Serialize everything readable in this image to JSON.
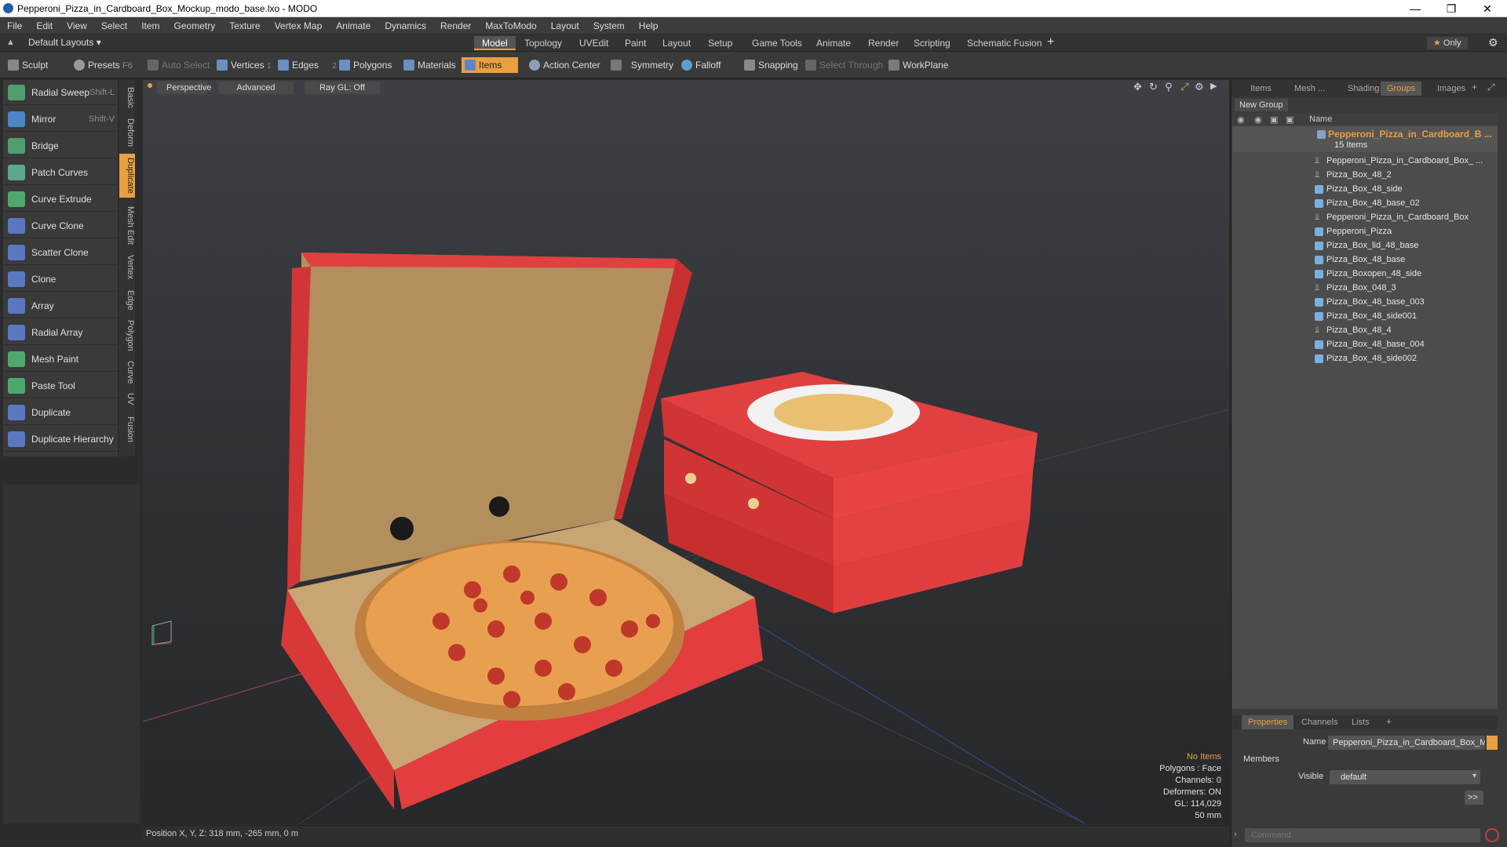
{
  "window": {
    "title": "Pepperoni_Pizza_in_Cardboard_Box_Mockup_modo_base.lxo - MODO"
  },
  "menu": [
    "File",
    "Edit",
    "View",
    "Select",
    "Item",
    "Geometry",
    "Texture",
    "Vertex Map",
    "Animate",
    "Dynamics",
    "Render",
    "MaxToModo",
    "Layout",
    "System",
    "Help"
  ],
  "layoutbar": {
    "layout_select": "Default Layouts",
    "tabs": [
      "Model",
      "Topology",
      "UVEdit",
      "Paint",
      "Layout",
      "Setup",
      "Game Tools",
      "Animate",
      "Render",
      "Scripting",
      "Schematic Fusion"
    ],
    "active_tab": "Model",
    "only_label": "Only"
  },
  "toolbar": {
    "sculpt": "Sculpt",
    "presets": "Presets",
    "presets_shortcut": "F6",
    "auto_select": "Auto Select",
    "vertices": "Vertices",
    "vertices_count": "1",
    "edges": "Edges",
    "edges_count": "2",
    "polygons": "Polygons",
    "materials": "Materials",
    "items": "Items",
    "action_center": "Action Center",
    "symmetry": "Symmetry",
    "falloff": "Falloff",
    "snapping": "Snapping",
    "select_through": "Select Through",
    "workplane": "WorkPlane"
  },
  "tools": [
    {
      "label": "Radial Sweep",
      "shortcut": "Shift-L"
    },
    {
      "label": "Mirror",
      "shortcut": "Shift-V"
    },
    {
      "label": "Bridge",
      "shortcut": ""
    },
    {
      "label": "Patch Curves",
      "shortcut": ""
    },
    {
      "label": "Curve Extrude",
      "shortcut": ""
    },
    {
      "label": "Curve Clone",
      "shortcut": ""
    },
    {
      "label": "Scatter Clone",
      "shortcut": ""
    },
    {
      "label": "Clone",
      "shortcut": ""
    },
    {
      "label": "Array",
      "shortcut": ""
    },
    {
      "label": "Radial Array",
      "shortcut": ""
    },
    {
      "label": "Mesh Paint",
      "shortcut": ""
    },
    {
      "label": "Paste Tool",
      "shortcut": ""
    },
    {
      "label": "Duplicate",
      "shortcut": ""
    },
    {
      "label": "Duplicate Hierarchy",
      "shortcut": ""
    }
  ],
  "vtabs": [
    "Basic",
    "Deform",
    "Duplicate",
    "Mesh Edit",
    "Vertex",
    "Edge",
    "Polygon",
    "Curve",
    "UV",
    "Fusion"
  ],
  "viewport": {
    "perspective": "Perspective",
    "advanced": "Advanced",
    "raygl": "Ray GL: Off",
    "info": {
      "no_items": "No Items",
      "polygons": "Polygons : Face",
      "channels": "Channels: 0",
      "deformers": "Deformers: ON",
      "gl": "GL: 114,029",
      "focal": "50 mm"
    }
  },
  "status": {
    "position": "Position X, Y, Z:  318 mm, -265 mm, 0 m"
  },
  "right_tabs": [
    "Items",
    "Mesh ...",
    "Shading",
    "Groups",
    "Images"
  ],
  "right_active": "Groups",
  "groups": {
    "new_group": "New Group",
    "col_name": "Name",
    "group_name": "Pepperoni_Pizza_in_Cardboard_B ...",
    "count": "15 Items",
    "items": [
      {
        "name": "Pepperoni_Pizza_in_Cardboard_Box_ ...",
        "type": "locator"
      },
      {
        "name": "Pizza_Box_48_2",
        "type": "locator"
      },
      {
        "name": "Pizza_Box_48_side",
        "type": "mesh"
      },
      {
        "name": "Pizza_Box_48_base_02",
        "type": "mesh"
      },
      {
        "name": "Pepperoni_Pizza_in_Cardboard_Box",
        "type": "locator"
      },
      {
        "name": "Pepperoni_Pizza",
        "type": "mesh"
      },
      {
        "name": "Pizza_Box_lid_48_base",
        "type": "mesh"
      },
      {
        "name": "Pizza_Box_48_base",
        "type": "mesh"
      },
      {
        "name": "Pizza_Boxopen_48_side",
        "type": "mesh"
      },
      {
        "name": "Pizza_Box_048_3",
        "type": "locator"
      },
      {
        "name": "Pizza_Box_48_base_003",
        "type": "mesh"
      },
      {
        "name": "Pizza_Box_48_side001",
        "type": "mesh"
      },
      {
        "name": "Pizza_Box_48_4",
        "type": "locator"
      },
      {
        "name": "Pizza_Box_48_base_004",
        "type": "mesh"
      },
      {
        "name": "Pizza_Box_48_side002",
        "type": "mesh"
      }
    ]
  },
  "props_tabs": [
    "Properties",
    "Channels",
    "Lists"
  ],
  "props": {
    "name_label": "Name",
    "name_value": "Pepperoni_Pizza_in_Cardboard_Box_M",
    "members": "Members",
    "visible_label": "Visible",
    "visible_value": "default",
    "more": ">>"
  },
  "command": {
    "placeholder": "Command"
  },
  "colors": {
    "accent": "#e8a040",
    "box_red": "#e03a3a",
    "cardboard": "#b89868"
  }
}
